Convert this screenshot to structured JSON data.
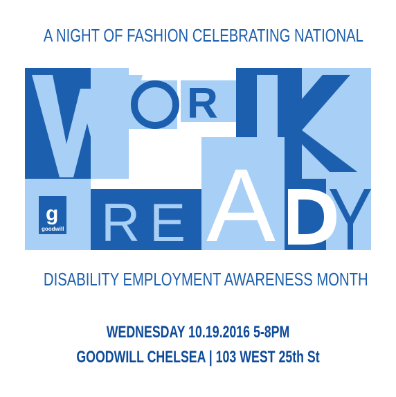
{
  "headline_top": "A NIGHT OF FASHION CELEBRATING NATIONAL",
  "headline_bottom": "DISABILITY EMPLOYMENT AWARENESS MONTH",
  "event_line_1": "WEDNESDAY 10.19.2016  5-8PM",
  "event_line_2": "GOODWILL CHELSEA |  103 WEST 25th St",
  "logo_text": "goodwill",
  "colors": {
    "dark_blue": "#1b5fae",
    "light_blue": "#a8cff5",
    "navy_text": "#0d4a9a",
    "white": "#ffffff"
  },
  "art": {
    "row1_letters": [
      "W",
      "O",
      "R",
      "K"
    ],
    "row2_letters": [
      "R",
      "E",
      "A",
      "D",
      "Y"
    ]
  }
}
